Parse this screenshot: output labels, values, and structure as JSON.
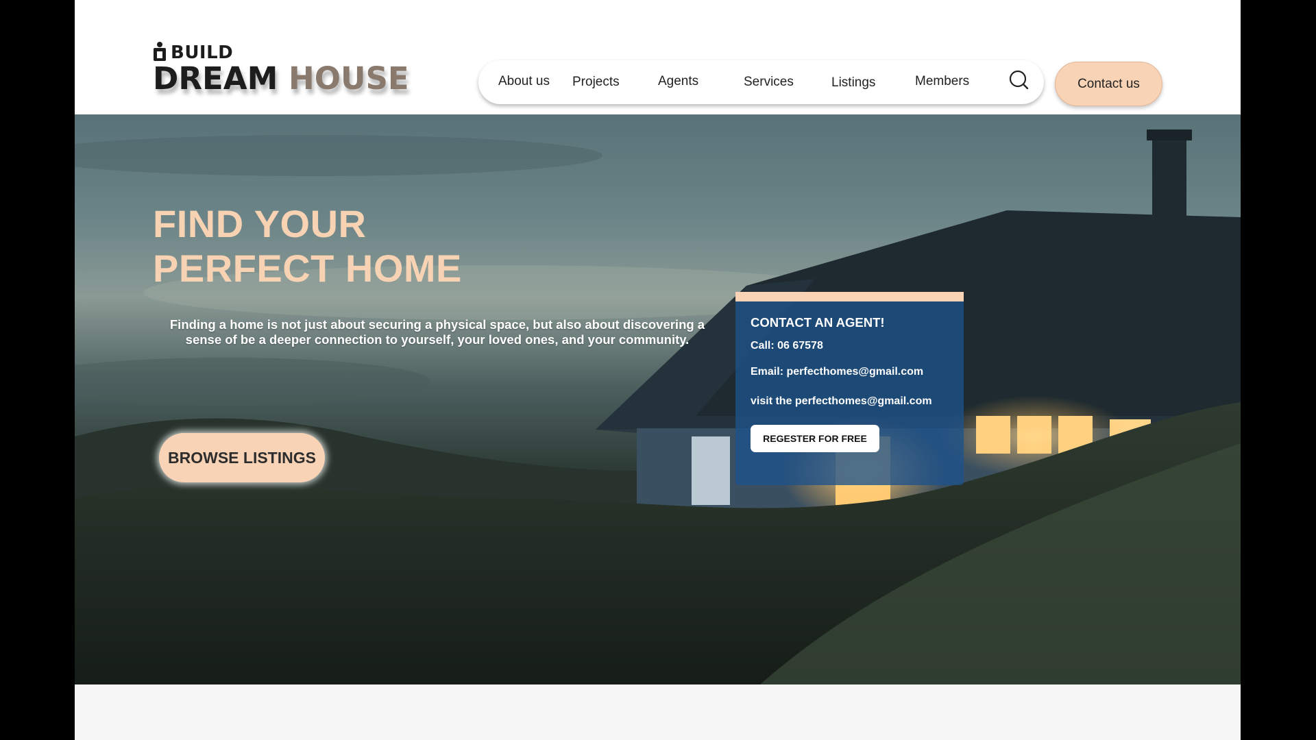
{
  "brand": {
    "top_text": "BUILD",
    "main_dark": "DREAM",
    "main_accent": "HOUSE",
    "accent_color": "#8a7a6d"
  },
  "nav": {
    "items": [
      "About us",
      "Projects",
      "Agents",
      "Services",
      "Listings",
      "Members"
    ],
    "search_icon": "search-icon"
  },
  "header": {
    "contact_label": "Contact us"
  },
  "hero": {
    "title_line1": "FIND YOUR",
    "title_line2": "PERFECT HOME",
    "description": "Finding a home is not just about securing a physical space, but also about discovering a sense of be a deeper connection to yourself, your loved ones, and your community.",
    "browse_label": "BROWSE LISTINGS"
  },
  "agent_card": {
    "heading": "CONTACT AN AGENT!",
    "call": "Call: 06 67578",
    "email": "Email: perfecthomes@gmail.com",
    "visit": "visit the perfecthomes@gmail.com",
    "register_label": "REGESTER FOR FREE"
  },
  "colors": {
    "accent_peach": "#f9d3b6",
    "card_blue": "#1e528a"
  }
}
